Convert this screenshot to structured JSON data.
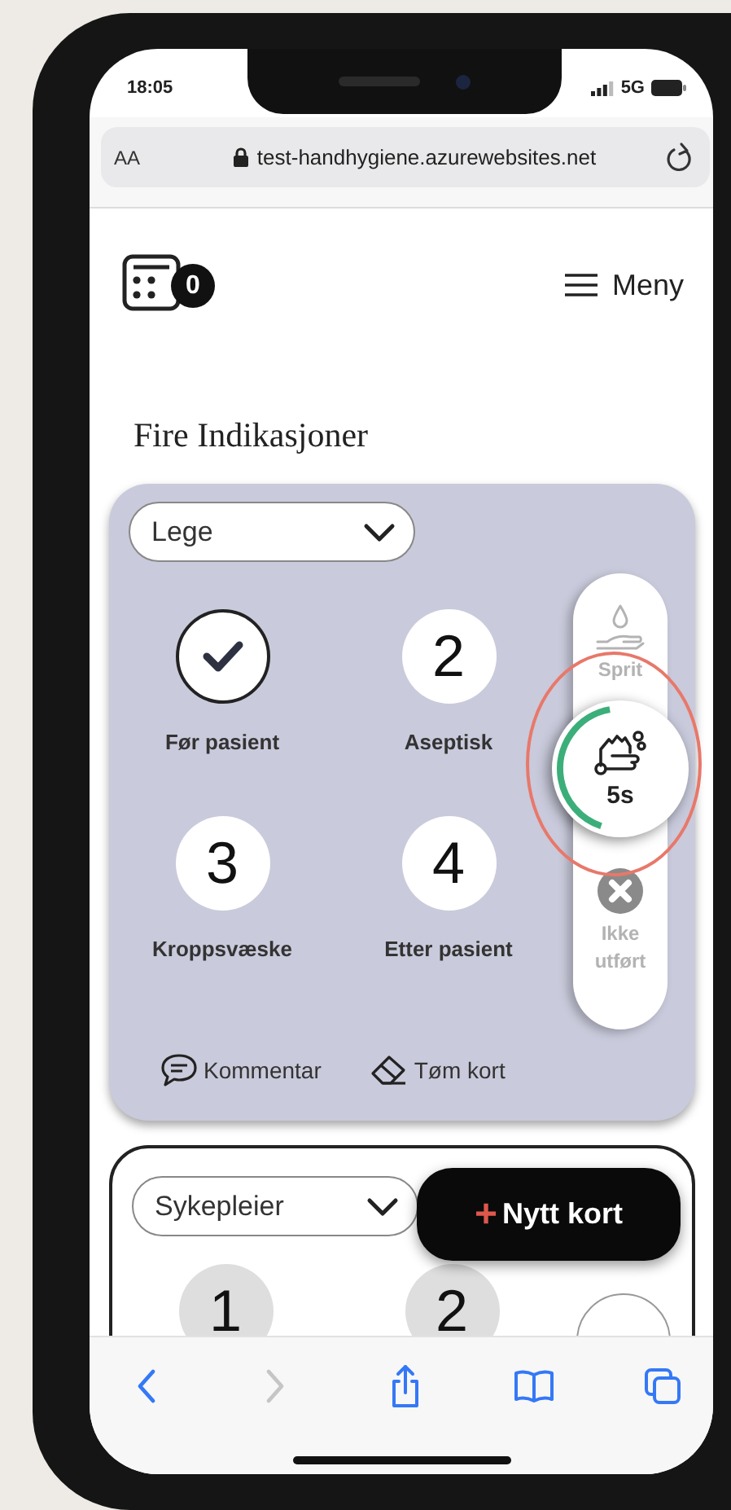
{
  "status_bar": {
    "time": "18:05",
    "network": "5G"
  },
  "browser": {
    "text_size_button": "AA",
    "url": "test-handhygiene.azurewebsites.net"
  },
  "header": {
    "counter_badge": "0",
    "menu_label": "Meny"
  },
  "title": "Fire Indikasjoner",
  "cards": [
    {
      "active": true,
      "role": "Lege",
      "indications": [
        {
          "done": true
        },
        {
          "number": "2",
          "done": false
        },
        {
          "number": "3",
          "done": false
        },
        {
          "number": "4",
          "done": false
        }
      ],
      "indication_labels": [
        "Før pasient",
        "Aseptisk",
        "Kroppsvæske",
        "Etter pasient"
      ],
      "actions": [
        {
          "kind": "sprit",
          "label": "Sprit",
          "selected": false
        },
        {
          "kind": "wash",
          "timer": "5s",
          "level": 0.42,
          "selected": true,
          "highlighted": true
        },
        {
          "kind": "not_done",
          "label": "Ikke utført",
          "selected": false
        }
      ],
      "footer": [
        {
          "kind": "comment",
          "label": "Kommentar"
        },
        {
          "kind": "clear",
          "label": "Tøm kort"
        }
      ]
    },
    {
      "active": false,
      "role": "Sykepleier",
      "indications": [
        {
          "number": "1",
          "done": false
        },
        {
          "number": "2",
          "done": false
        }
      ]
    }
  ],
  "new_card_button": {
    "icon": "+",
    "label": "Nytt kort"
  },
  "toolbar": [
    {
      "kind": "back",
      "disabled": false
    },
    {
      "kind": "forward",
      "disabled": true
    },
    {
      "kind": "share",
      "disabled": false
    },
    {
      "kind": "bookmarks",
      "disabled": false
    },
    {
      "kind": "tabs",
      "disabled": false
    }
  ]
}
